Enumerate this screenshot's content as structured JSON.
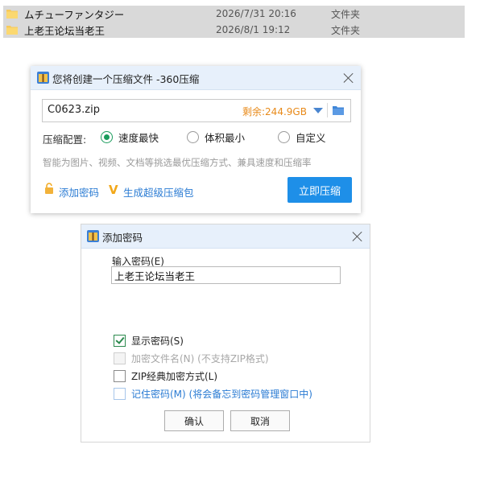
{
  "file_list": [
    {
      "name": "ムチューファンタジー",
      "date": "2026/7/31 20:16",
      "type": "文件夹",
      "icon": "folder-icon"
    },
    {
      "name": "上老王论坛当老王",
      "date": "2026/8/1 19:12",
      "type": "文件夹",
      "icon": "folder-icon"
    }
  ],
  "compress_dialog": {
    "title": "您将创建一个压缩文件 -360压缩",
    "path_value": "C0623.zip",
    "free_space": "剩余:244.9GB",
    "config_label": "压缩配置:",
    "options": [
      {
        "label": "速度最快",
        "selected": true
      },
      {
        "label": "体积最小",
        "selected": false
      },
      {
        "label": "自定义",
        "selected": false
      }
    ],
    "hint": "智能为图片、视频、文档等挑选最优压缩方式、兼具速度和压缩率",
    "add_password_link": "添加密码",
    "super_compress_link": "生成超级压缩包",
    "compress_button": "立即压缩",
    "accent_color": "#1e8fe8"
  },
  "password_dialog": {
    "title": "添加密码",
    "input_label": "输入密码(E)",
    "password_value": "上老王论坛当老王",
    "checkboxes": [
      {
        "label": "显示密码(S)",
        "checked": true,
        "enabled": true
      },
      {
        "label": "加密文件名(N) (不支持ZIP格式)",
        "checked": false,
        "enabled": false
      },
      {
        "label": "ZIP经典加密方式(L)",
        "checked": false,
        "enabled": true
      },
      {
        "label": "记住密码(M) (将会备忘到密码管理窗口中)",
        "checked": false,
        "enabled": true
      }
    ],
    "ok_button": "确认",
    "cancel_button": "取消"
  }
}
